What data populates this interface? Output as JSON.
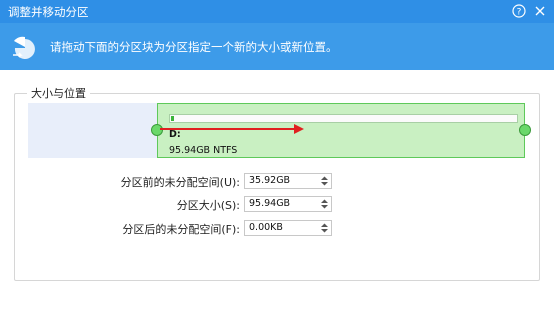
{
  "window": {
    "title": "调整并移动分区"
  },
  "banner": {
    "text": "请拖动下面的分区块为分区指定一个新的大小或新位置。"
  },
  "group": {
    "title": "大小与位置"
  },
  "partition": {
    "label": "D:",
    "size_fs": "95.94GB NTFS",
    "used_fraction": 0.01
  },
  "form": {
    "unalloc_before": {
      "label": "分区前的未分配空间(U):",
      "value": "35.92GB"
    },
    "partition_size": {
      "label": "分区大小(S):",
      "value": "95.94GB"
    },
    "unalloc_after": {
      "label": "分区后的未分配空间(F):",
      "value": "0.00KB"
    }
  },
  "colors": {
    "titlebar": "#2f8fe6",
    "banner": "#3d9be9",
    "partition_fill": "#c9f0c2",
    "partition_border": "#5ec95a",
    "unallocated": "#e8eefa",
    "arrow": "#e02020"
  }
}
